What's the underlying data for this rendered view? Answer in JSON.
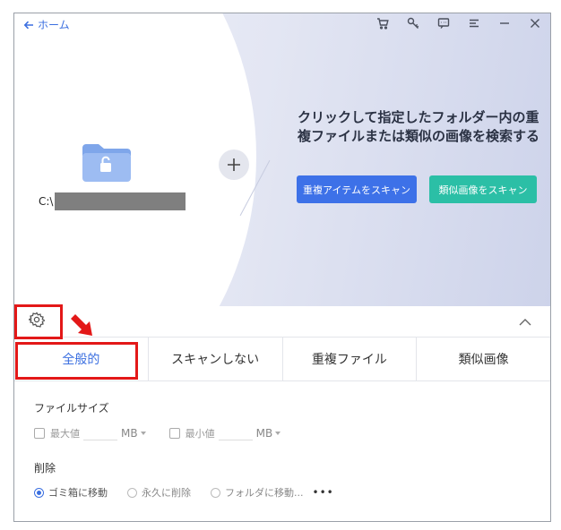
{
  "header": {
    "back_label": "ホーム",
    "toolbar_icons": [
      "cart-icon",
      "key-icon",
      "feedback-icon",
      "menu-icon",
      "minimize-icon",
      "close-icon"
    ]
  },
  "hero": {
    "path_prefix": "C:\\",
    "headline": "クリックして指定したフォルダー内の重複ファイルまたは類似の画像を検索する",
    "scan_duplicates_label": "重複アイテムをスキャン",
    "scan_similar_label": "類似画像をスキャン"
  },
  "tabs": [
    {
      "label": "全般的",
      "active": true
    },
    {
      "label": "スキャンしない",
      "active": false
    },
    {
      "label": "重複ファイル",
      "active": false
    },
    {
      "label": "類似画像",
      "active": false
    }
  ],
  "general": {
    "file_size_title": "ファイルサイズ",
    "max_label": "最大値",
    "max_unit": "MB",
    "min_label": "最小値",
    "min_unit": "MB",
    "delete_title": "削除",
    "delete_options": [
      {
        "label": "ゴミ箱に移動",
        "selected": true
      },
      {
        "label": "永久に削除",
        "selected": false
      },
      {
        "label": "フォルダに移動...",
        "selected": false
      }
    ],
    "more_label": "•••"
  },
  "colors": {
    "accent": "#3d71e8",
    "teal": "#2bbfa6",
    "highlight": "#e31818"
  }
}
